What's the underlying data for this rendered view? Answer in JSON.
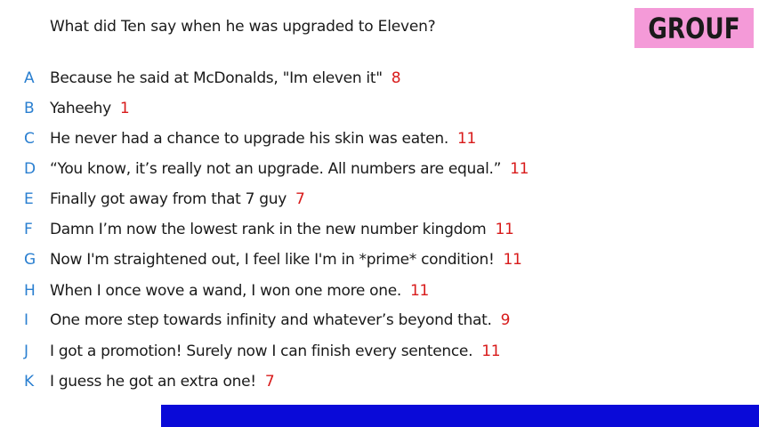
{
  "question": "What did Ten say when he was upgraded to Eleven?",
  "badge": "GROUF",
  "colors": {
    "letter": "#2a7fd0",
    "score": "#d81b1b",
    "badge_bg": "#f49ad8",
    "bar": "#0a0ad8"
  },
  "answers": [
    {
      "letter": "A",
      "text": "Because he said at McDonalds, \"Im eleven it\"",
      "score": "8"
    },
    {
      "letter": "B",
      "text": "Yaheehy",
      "score": "1"
    },
    {
      "letter": "C",
      "text": "He never had a chance to upgrade his skin was eaten.",
      "score": "11"
    },
    {
      "letter": "D",
      "text": "“You know, it’s really not an upgrade. All numbers are equal.”",
      "score": "11"
    },
    {
      "letter": "E",
      "text": "Finally got away from that 7 guy",
      "score": "7"
    },
    {
      "letter": "F",
      "text": "Damn I’m now the lowest rank in the new number kingdom",
      "score": "11"
    },
    {
      "letter": "G",
      "text": "Now I'm straightened out, I feel like I'm in *prime* condition!",
      "score": "11"
    },
    {
      "letter": "H",
      "text": "When I once wove a wand, I won one more one.",
      "score": "11"
    },
    {
      "letter": "I",
      "text": "One more step towards infinity and whatever’s beyond that.",
      "score": "9"
    },
    {
      "letter": "J",
      "text": "I got a promotion! Surely now I can finish every sentence.",
      "score": "11"
    },
    {
      "letter": "K",
      "text": "I guess he got an extra one!",
      "score": "7"
    }
  ]
}
